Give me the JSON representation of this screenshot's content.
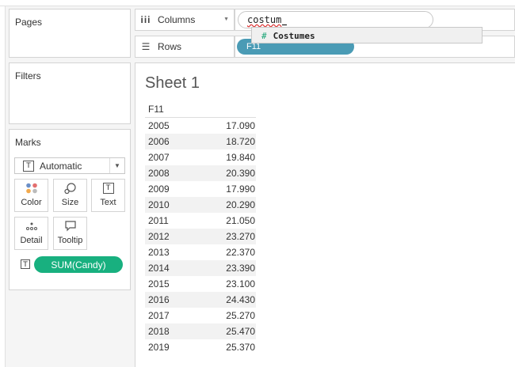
{
  "panels": {
    "pages": "Pages",
    "filters": "Filters",
    "marks": "Marks"
  },
  "marks": {
    "type_selected": "Automatic",
    "buttons": [
      "Color",
      "Size",
      "Text",
      "Detail",
      "Tooltip"
    ],
    "pill": "SUM(Candy)"
  },
  "shelves": {
    "columns_label": "Columns",
    "rows_label": "Rows",
    "columns_input": "costum",
    "rows_pill": "F11"
  },
  "autocomplete": {
    "items": [
      {
        "icon": "#",
        "label": "Costumes"
      }
    ]
  },
  "sheet": {
    "title": "Sheet 1",
    "column_header": "F11",
    "rows": [
      {
        "year": "2005",
        "value": "17.090"
      },
      {
        "year": "2006",
        "value": "18.720"
      },
      {
        "year": "2007",
        "value": "19.840"
      },
      {
        "year": "2008",
        "value": "20.390"
      },
      {
        "year": "2009",
        "value": "17.990"
      },
      {
        "year": "2010",
        "value": "20.290"
      },
      {
        "year": "2011",
        "value": "21.050"
      },
      {
        "year": "2012",
        "value": "23.270"
      },
      {
        "year": "2013",
        "value": "22.370"
      },
      {
        "year": "2014",
        "value": "23.390"
      },
      {
        "year": "2015",
        "value": "23.100"
      },
      {
        "year": "2016",
        "value": "24.430"
      },
      {
        "year": "2017",
        "value": "25.270"
      },
      {
        "year": "2018",
        "value": "25.470"
      },
      {
        "year": "2019",
        "value": "25.370"
      }
    ]
  },
  "colors": {
    "dimension_pill": "#4a9bb5",
    "measure_pill": "#18b07f",
    "number_icon": "#18a374"
  }
}
